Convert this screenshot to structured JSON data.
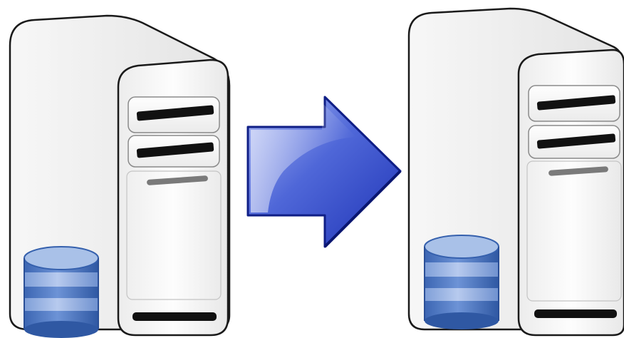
{
  "diagram": {
    "nodes": [
      {
        "id": "source-server",
        "icon": "server-tower-icon",
        "storage_icon": "database-icon"
      },
      {
        "id": "target-server",
        "icon": "server-tower-icon",
        "storage_icon": "database-icon"
      }
    ],
    "edges": [
      {
        "from": "source-server",
        "to": "target-server",
        "icon": "arrow-right-icon"
      }
    ]
  },
  "colors": {
    "background": "#ffffff",
    "server_body": "#f4f4f4",
    "server_front": "#fafafa",
    "outline": "#1a1a1a",
    "drive_slot": "#111111",
    "vent_slot": "#777777",
    "database_light": "#a9c1e8",
    "database_mid": "#5a83c8",
    "database_dark": "#3560ad",
    "arrow_light": "#8da0ee",
    "arrow_dark": "#1f34b8",
    "arrow_outline": "#0f1e86"
  }
}
